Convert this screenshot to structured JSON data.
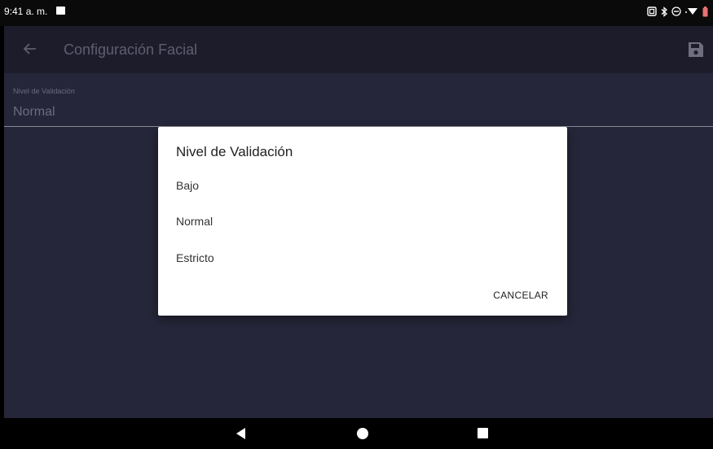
{
  "status_bar": {
    "time": "9:41 a. m.",
    "icons": [
      "image-notification-icon",
      "screenshot-icon",
      "bluetooth-icon",
      "dnd-icon",
      "wifi-icon",
      "battery-icon"
    ]
  },
  "toolbar": {
    "title": "Configuración Facial",
    "back_icon": "arrow-back-icon",
    "save_icon": "save-icon"
  },
  "field": {
    "label": "Nivel de Validación",
    "value": "Normal"
  },
  "dialog": {
    "title": "Nivel de Validación",
    "options": [
      "Bajo",
      "Normal",
      "Estricto"
    ],
    "cancel_label": "CANCELAR"
  },
  "colors": {
    "app_background": "#26263a",
    "toolbar_background": "#1c1c2b",
    "dialog_background": "#ffffff",
    "battery": "#e57373"
  }
}
